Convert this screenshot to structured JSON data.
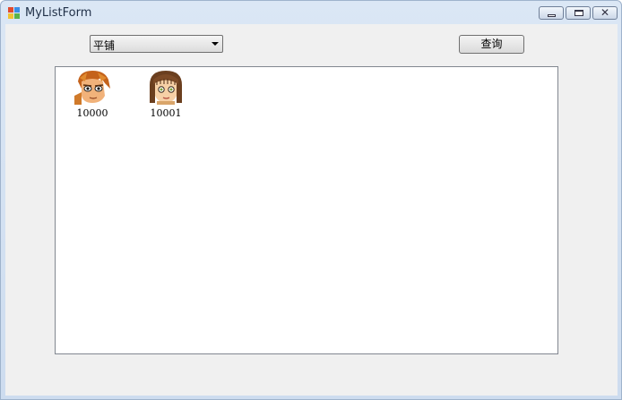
{
  "window": {
    "title": "MyListForm",
    "icons": [
      "app-icon",
      "minimize-icon",
      "maximize-icon",
      "close-icon"
    ]
  },
  "toolbar": {
    "view_mode_selected": "平铺",
    "query_label": "查询"
  },
  "listview": {
    "items": [
      {
        "label": "10000",
        "icon": "male-avatar-icon"
      },
      {
        "label": "10001",
        "icon": "female-avatar-icon"
      }
    ]
  },
  "colors": {
    "titlebar": "#cddcef",
    "client_bg": "#f0f0f0",
    "list_bg": "#ffffff",
    "list_border": "#828790"
  }
}
